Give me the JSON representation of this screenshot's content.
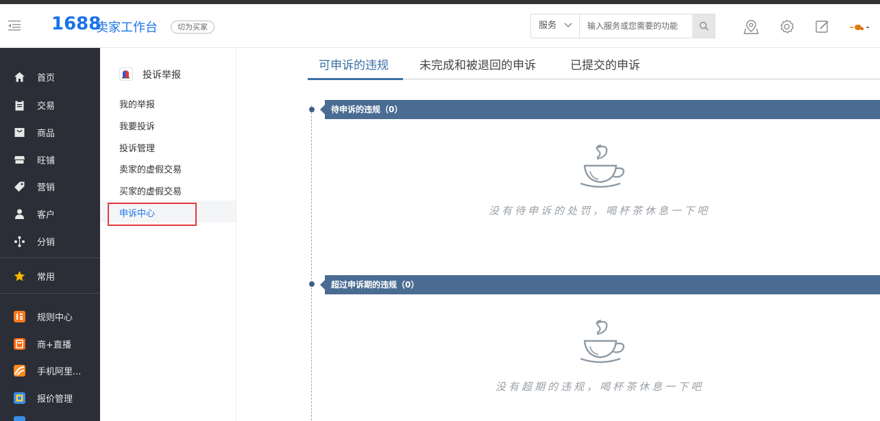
{
  "header": {
    "brand_number": "1688",
    "brand_title": "卖家工作台",
    "switch_label": "切为买家",
    "search": {
      "type_label": "服务",
      "placeholder": "输入服务或您需要的功能"
    },
    "icons": [
      "map-pin-icon",
      "settings-icon",
      "edit-icon"
    ]
  },
  "leftnav": {
    "items": [
      {
        "label": "首页",
        "icon": "home-icon"
      },
      {
        "label": "交易",
        "icon": "clipboard-icon"
      },
      {
        "label": "商品",
        "icon": "bag-icon"
      },
      {
        "label": "旺铺",
        "icon": "store-icon"
      },
      {
        "label": "营销",
        "icon": "tag-icon"
      },
      {
        "label": "客户",
        "icon": "user-icon"
      },
      {
        "label": "分销",
        "icon": "share-icon"
      },
      {
        "label": "常用",
        "icon": "star-icon"
      },
      {
        "label": "规则中心",
        "icon": "rules-app-icon"
      },
      {
        "label": "商+直播",
        "icon": "live-app-icon"
      },
      {
        "label": "手机阿里...",
        "icon": "mobile-app-icon"
      },
      {
        "label": "报价管理",
        "icon": "quote-app-icon"
      }
    ]
  },
  "subnav": {
    "title": "投诉举报",
    "items": [
      "我的举报",
      "我要投诉",
      "投诉管理",
      "卖家的虚假交易",
      "买家的虚假交易",
      "申诉中心"
    ],
    "active_index": 5
  },
  "main": {
    "tabs": [
      "可申诉的违规",
      "未完成和被退回的申诉",
      "已提交的申诉"
    ],
    "active_tab": 0,
    "sections": [
      {
        "title": "待申诉的违规（0）",
        "empty_text": "没有待申诉的处罚，喝杯茶休息一下吧"
      },
      {
        "title": "超过申诉期的违规（0）",
        "empty_text": "没有超期的违规，喝杯茶休息一下吧"
      }
    ]
  },
  "colors": {
    "brand": "#1a73e8",
    "nav_bg": "#2b2e36",
    "section_bar": "#4a6c92",
    "active_tab": "#3b6fa5",
    "highlight_box": "#e4393c"
  }
}
